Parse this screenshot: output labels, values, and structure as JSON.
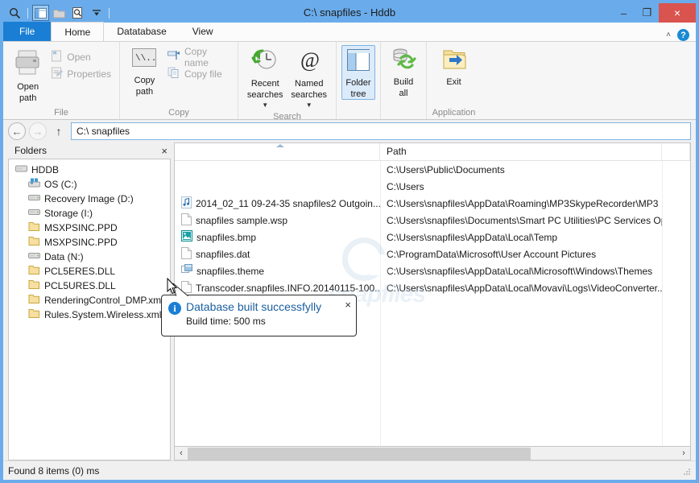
{
  "titlebar": {
    "title": "C:\\ snapfiles - Hddb",
    "quick_access": [
      {
        "name": "search-icon",
        "label": "Search"
      },
      {
        "name": "folder-tree-icon",
        "label": "Folder tree",
        "selected": true
      },
      {
        "name": "folder-icon",
        "label": "Open folder"
      },
      {
        "name": "find-file-icon",
        "label": "Find file"
      },
      {
        "name": "chevron-down-icon",
        "label": "Customize"
      }
    ],
    "minimize": "–",
    "maximize": "❐",
    "close": "×"
  },
  "ribbon": {
    "tabs": [
      {
        "label": "File",
        "kind": "file"
      },
      {
        "label": "Home",
        "kind": "active"
      },
      {
        "label": "Datatabase",
        "kind": "normal"
      },
      {
        "label": "View",
        "kind": "normal"
      }
    ],
    "collapse_label": "˄",
    "help_label": "?",
    "groups": [
      {
        "label": "File",
        "big": [
          {
            "label_line1": "Open",
            "label_line2": "path",
            "icon": "open-path-printer-icon"
          }
        ],
        "small": [
          {
            "label": "Open",
            "icon": "open-icon",
            "disabled": true
          },
          {
            "label": "Properties",
            "icon": "properties-icon",
            "disabled": true
          }
        ]
      },
      {
        "label": "Copy",
        "big": [
          {
            "label_line1": "Copy",
            "label_line2": "path",
            "icon": "copy-path-unc-icon"
          }
        ],
        "small": [
          {
            "label": "Copy name",
            "icon": "copy-name-icon",
            "disabled": true
          },
          {
            "label": "Copy file",
            "icon": "copy-file-icon",
            "disabled": true
          }
        ]
      },
      {
        "label": "Search",
        "big": [
          {
            "label_line1": "Recent",
            "label_line2": "searches",
            "icon": "recent-searches-clock-icon",
            "dropdown": true
          },
          {
            "label_line1": "Named",
            "label_line2": "searches",
            "icon": "named-searches-at-icon",
            "dropdown": true
          }
        ],
        "small": []
      },
      {
        "label": "",
        "big": [
          {
            "label_line1": "Folder",
            "label_line2": "tree",
            "icon": "folder-tree-icon",
            "selected": true
          }
        ],
        "small": []
      },
      {
        "label": "",
        "big": [
          {
            "label_line1": "Build",
            "label_line2": "all",
            "icon": "build-all-database-icon"
          }
        ],
        "small": []
      },
      {
        "label": "Application",
        "big": [
          {
            "label_line1": "Exit",
            "label_line2": "",
            "icon": "exit-folder-arrow-icon"
          }
        ],
        "small": []
      }
    ]
  },
  "addressbar": {
    "back": "←",
    "forward": "→",
    "up": "↑",
    "value": "C:\\ snapfiles",
    "placeholder": "Enter path"
  },
  "tree": {
    "header": "Folders",
    "close_label": "×",
    "items": [
      {
        "label": "HDDB",
        "icon": "drive-icon",
        "level": 0
      },
      {
        "label": "OS (C:)",
        "icon": "windows-drive-icon",
        "level": 1
      },
      {
        "label": "Recovery Image (D:)",
        "icon": "drive-icon",
        "level": 1
      },
      {
        "label": "Storage (I:)",
        "icon": "drive-icon",
        "level": 1
      },
      {
        "label": "MSXPSINC.PPD",
        "icon": "folder-icon",
        "level": 1
      },
      {
        "label": "MSXPSINC.PPD",
        "icon": "folder-icon",
        "level": 1
      },
      {
        "label": "Data (N:)",
        "icon": "drive-icon",
        "level": 1
      },
      {
        "label": "PCL5ERES.DLL",
        "icon": "folder-icon",
        "level": 1
      },
      {
        "label": "PCL5URES.DLL",
        "icon": "folder-icon",
        "level": 1
      },
      {
        "label": "RenderingControl_DMP.xml",
        "icon": "folder-icon",
        "level": 1
      },
      {
        "label": "Rules.System.Wireless.xml",
        "icon": "folder-icon",
        "level": 1
      }
    ]
  },
  "filelist": {
    "columns": [
      {
        "label": "",
        "key": "name"
      },
      {
        "label": "Path",
        "key": "path"
      },
      {
        "label": "",
        "key": "extra"
      }
    ],
    "rows": [
      {
        "name": "",
        "icon": "",
        "path": "C:\\Users\\Public\\Documents"
      },
      {
        "name": "",
        "icon": "",
        "path": "C:\\Users"
      },
      {
        "name": "2014_02_11 09-24-35 snapfiles2 Outgoin...",
        "icon": "audio-file-icon",
        "path": "C:\\Users\\snapfiles\\AppData\\Roaming\\MP3SkypeRecorder\\MP3"
      },
      {
        "name": "snapfiles sample.wsp",
        "icon": "generic-file-icon",
        "path": "C:\\Users\\snapfiles\\Documents\\Smart PC Utilities\\PC Services Op..."
      },
      {
        "name": "snapfiles.bmp",
        "icon": "image-file-icon",
        "path": "C:\\Users\\snapfiles\\AppData\\Local\\Temp"
      },
      {
        "name": "snapfiles.dat",
        "icon": "generic-file-icon",
        "path": "C:\\ProgramData\\Microsoft\\User Account Pictures"
      },
      {
        "name": "snapfiles.theme",
        "icon": "theme-file-icon",
        "path": "C:\\Users\\snapfiles\\AppData\\Local\\Microsoft\\Windows\\Themes"
      },
      {
        "name": "Transcoder.snapfiles.INFO.20140115-100...",
        "icon": "generic-file-icon",
        "path": "C:\\Users\\snapfiles\\AppData\\Local\\Movavi\\Logs\\VideoConverter..."
      }
    ],
    "hscroll": {
      "left_arrow": "‹",
      "right_arrow": "›"
    }
  },
  "popup": {
    "title": "Database built successfylly",
    "subtitle": "Build time: 500 ms",
    "close_label": "×",
    "info_label": "i"
  },
  "statusbar": {
    "text": "Found 8 items (0) ms"
  },
  "watermark": {
    "text": "snapfiles"
  },
  "colors": {
    "window_frame": "#6aaceb",
    "accent": "#1a7fd4",
    "close_red": "#d9534f",
    "ribbon_bg": "#f6f6f6",
    "selected_blue": "#dcebfa"
  }
}
